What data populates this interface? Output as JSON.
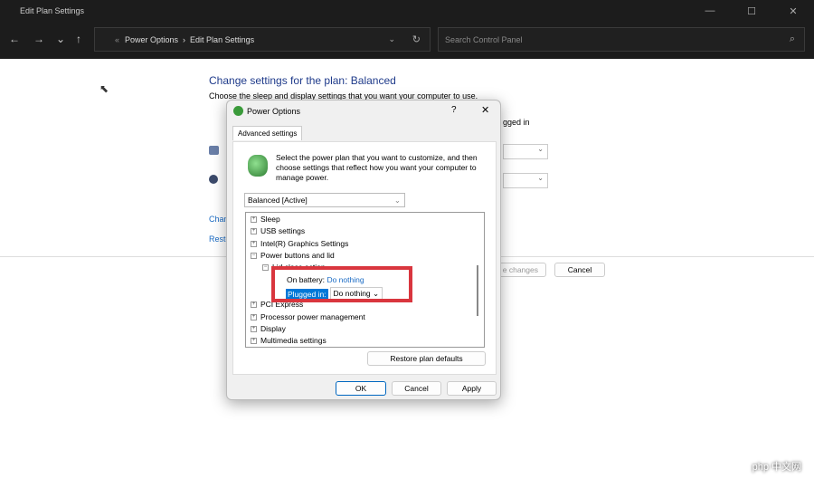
{
  "window": {
    "title": "Edit Plan Settings",
    "min": "—",
    "max": "☐",
    "close": "✕"
  },
  "nav": {
    "back": "←",
    "forward": "→",
    "recent": "⌄",
    "up": "↑"
  },
  "address": {
    "prefix": "«",
    "crumbs": [
      "Power Options",
      "Edit Plan Settings"
    ],
    "sep": "›",
    "refresh": "↻",
    "dropdown": "⌄"
  },
  "search": {
    "placeholder": "Search Control Panel",
    "icon": "⌕"
  },
  "background": {
    "title": "Change settings for the plan: Balanced",
    "subtitle": "Choose the sleep and display settings that you want your computer to use.",
    "plugged_fragment": "gged in",
    "link1_fragment": "Chan",
    "link2_fragment": "Resto",
    "save_fragment": "e changes",
    "cancel": "Cancel"
  },
  "dialog": {
    "title": "Power Options",
    "help": "?",
    "close": "✕",
    "tab": "Advanced settings",
    "description": "Select the power plan that you want to customize, and then choose settings that reflect how you want your computer to manage power.",
    "plan": "Balanced [Active]",
    "tree": [
      {
        "label": "Sleep",
        "state": "+"
      },
      {
        "label": "USB settings",
        "state": "+"
      },
      {
        "label": "Intel(R) Graphics Settings",
        "state": "+"
      },
      {
        "label": "Power buttons and lid",
        "state": "−"
      },
      {
        "label": "Lid close action",
        "state": "−"
      },
      {
        "label": "PCI Express",
        "state": "+"
      },
      {
        "label": "Processor power management",
        "state": "+"
      },
      {
        "label": "Display",
        "state": "+"
      },
      {
        "label": "Multimedia settings",
        "state": "+"
      }
    ],
    "on_battery_label": "On battery:",
    "on_battery_value": "Do nothing",
    "plugged_label": "Plugged in:",
    "plugged_value": "Do nothing",
    "restore": "Restore plan defaults",
    "ok": "OK",
    "cancel": "Cancel",
    "apply": "Apply"
  },
  "colors": {
    "highlight": "#0078d7",
    "annotation": "#d9363e",
    "link": "#1a6bc4"
  },
  "watermark": "php 中文网"
}
